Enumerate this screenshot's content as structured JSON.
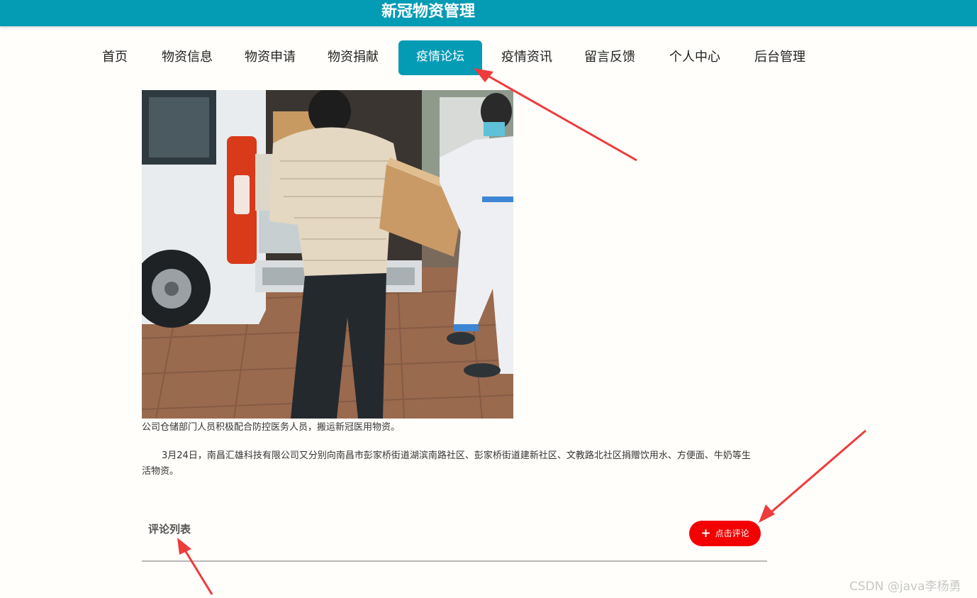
{
  "header": {
    "site_title": "新冠物资管理"
  },
  "nav": {
    "items": [
      {
        "label": "首页"
      },
      {
        "label": "物资信息"
      },
      {
        "label": "物资申请"
      },
      {
        "label": "物资捐献"
      },
      {
        "label": "疫情论坛",
        "active": true
      },
      {
        "label": "疫情资讯"
      },
      {
        "label": "留言反馈"
      },
      {
        "label": "个人中心"
      },
      {
        "label": "后台管理"
      }
    ]
  },
  "article": {
    "caption": "公司仓储部门人员积极配合防控医务人员，搬运新冠医用物资。",
    "paragraph": "3月24日，南昌汇雄科技有限公司又分别向南昌市彭家桥街道湖滨南路社区、彭家桥街道建新社区、文教路北社区捐赠饮用水、方便面、牛奶等生活物资。"
  },
  "comments": {
    "title": "评论列表",
    "add_button_label": "点击评论",
    "add_button_icon": "plus-icon"
  },
  "watermark": "CSDN @java李杨勇",
  "colors": {
    "primary": "#049bb5",
    "button_red": "#f30000",
    "annotation_arrow": "#ee3b3b"
  }
}
